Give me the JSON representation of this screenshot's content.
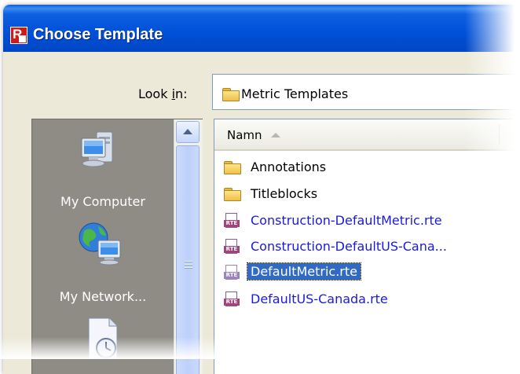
{
  "dialog": {
    "title": "Choose Template",
    "app_icon_letter": "R"
  },
  "look_in": {
    "label_prefix": "Look ",
    "label_mnemonic": "i",
    "label_suffix": "n:",
    "value": "Metric Templates"
  },
  "places": [
    {
      "label": "My Computer",
      "icon": "my-computer-icon"
    },
    {
      "label": "My Network...",
      "icon": "my-network-icon"
    },
    {
      "label": "",
      "icon": "recent-documents-icon"
    }
  ],
  "file_list": {
    "column_header": "Namn",
    "sort": "ascending",
    "items": [
      {
        "name": "Annotations",
        "type": "folder",
        "selected": false
      },
      {
        "name": "Titleblocks",
        "type": "folder",
        "selected": false
      },
      {
        "name": "Construction-DefaultMetric.rte",
        "type": "rte",
        "selected": false
      },
      {
        "name": "Construction-DefaultUS-Cana...",
        "type": "rte",
        "selected": false
      },
      {
        "name": "DefaultMetric.rte",
        "type": "rte",
        "selected": true
      },
      {
        "name": "DefaultUS-Canada.rte",
        "type": "rte",
        "selected": false
      }
    ],
    "file_icon_badge": "RTE"
  },
  "colors": {
    "titlebar": "#0054e3",
    "dialog_bg": "#ece9d8",
    "selection": "#316ac5",
    "file_link": "#1a1adc"
  }
}
